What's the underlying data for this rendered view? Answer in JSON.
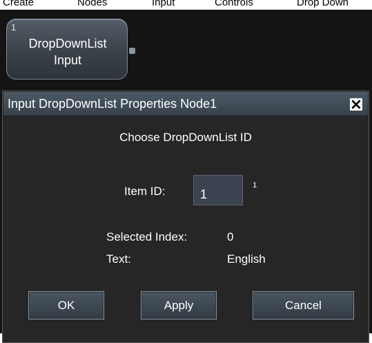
{
  "breadcrumb": [
    "Create",
    "Nodes",
    "Input",
    "Controls",
    "Drop Down"
  ],
  "node": {
    "number": "1",
    "title": "DropDownList",
    "subtitle": "Input"
  },
  "dialog": {
    "title": "Input DropDownList Properties Node1",
    "heading": "Choose DropDownList ID",
    "item_id_label": "Item ID:",
    "item_id_value": "1",
    "item_id_superscript": "1",
    "selected_index_label": "Selected Index:",
    "selected_index_value": "0",
    "text_label": "Text:",
    "text_value": "English",
    "buttons": {
      "ok": "OK",
      "apply": "Apply",
      "cancel": "Cancel"
    }
  },
  "colors": {
    "canvas_background": "#141414",
    "dialog_background": "#262626",
    "titlebar": "#3f4b56",
    "node_fill": "#3a4149"
  },
  "icons": {
    "close": "close-icon"
  }
}
